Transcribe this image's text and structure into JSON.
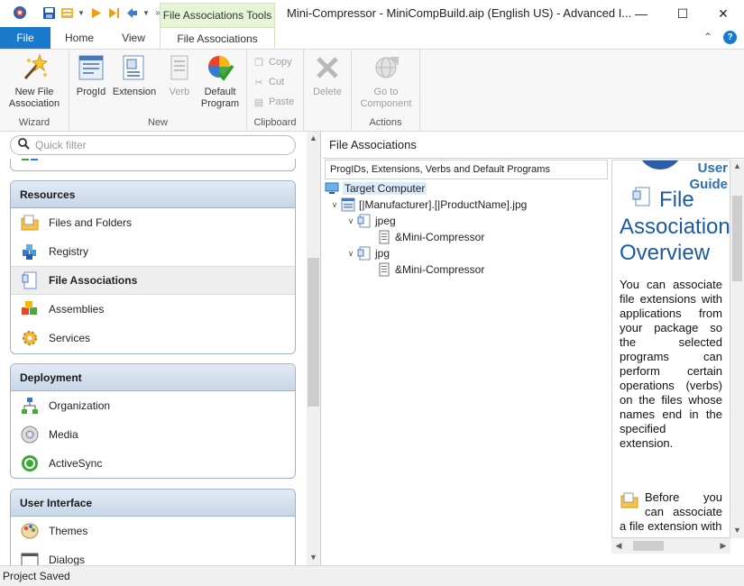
{
  "titlebar": {
    "context_tab_title": "File Associations Tools",
    "window_title": "Mini-Compressor - MiniCompBuild.aip (English US) - Advanced I...",
    "minimize": "—",
    "maximize": "☐",
    "close": "✕"
  },
  "tabs": {
    "file": "File",
    "home": "Home",
    "view": "View",
    "file_associations": "File Associations",
    "collapse": "⌃",
    "help": "?"
  },
  "ribbon": {
    "wizard": {
      "label": "Wizard",
      "new_file_association": "New File Association"
    },
    "new": {
      "label": "New",
      "progid": "ProgId",
      "extension": "Extension",
      "verb": "Verb",
      "default_program": "Default Program"
    },
    "clipboard": {
      "label": "Clipboard",
      "copy": "Copy",
      "cut": "Cut",
      "paste": "Paste"
    },
    "delete": "Delete",
    "actions": {
      "label": "Actions",
      "go_to_component": "Go to Component"
    }
  },
  "left": {
    "search_placeholder": "Quick filter",
    "resources": {
      "title": "Resources",
      "items": [
        "Files and Folders",
        "Registry",
        "File Associations",
        "Assemblies",
        "Services"
      ]
    },
    "deployment": {
      "title": "Deployment",
      "items": [
        "Organization",
        "Media",
        "ActiveSync"
      ]
    },
    "user_interface": {
      "title": "User Interface",
      "items": [
        "Themes",
        "Dialogs"
      ]
    }
  },
  "right": {
    "header": "File Associations",
    "tree_header": "ProgIDs, Extensions, Verbs and Default Programs",
    "tree": {
      "root": "Target Computer",
      "progid": "[|Manufacturer].[|ProductName].jpg",
      "ext1": "jpeg",
      "verb1": "&Mini-Compressor",
      "ext2": "jpg",
      "verb2": "&Mini-Compressor"
    },
    "guide": {
      "top_link": "User Guide",
      "title_line1": "File",
      "title_line2": "Associations",
      "title_line3": "Overview",
      "body": "You can associate file extensions with applications from your package so the selected programs can perform certain operations (verbs) on the files whose names end in the specified extension.",
      "body2": "Before you can associate a file extension with"
    }
  },
  "status": {
    "text": "Project Saved"
  }
}
